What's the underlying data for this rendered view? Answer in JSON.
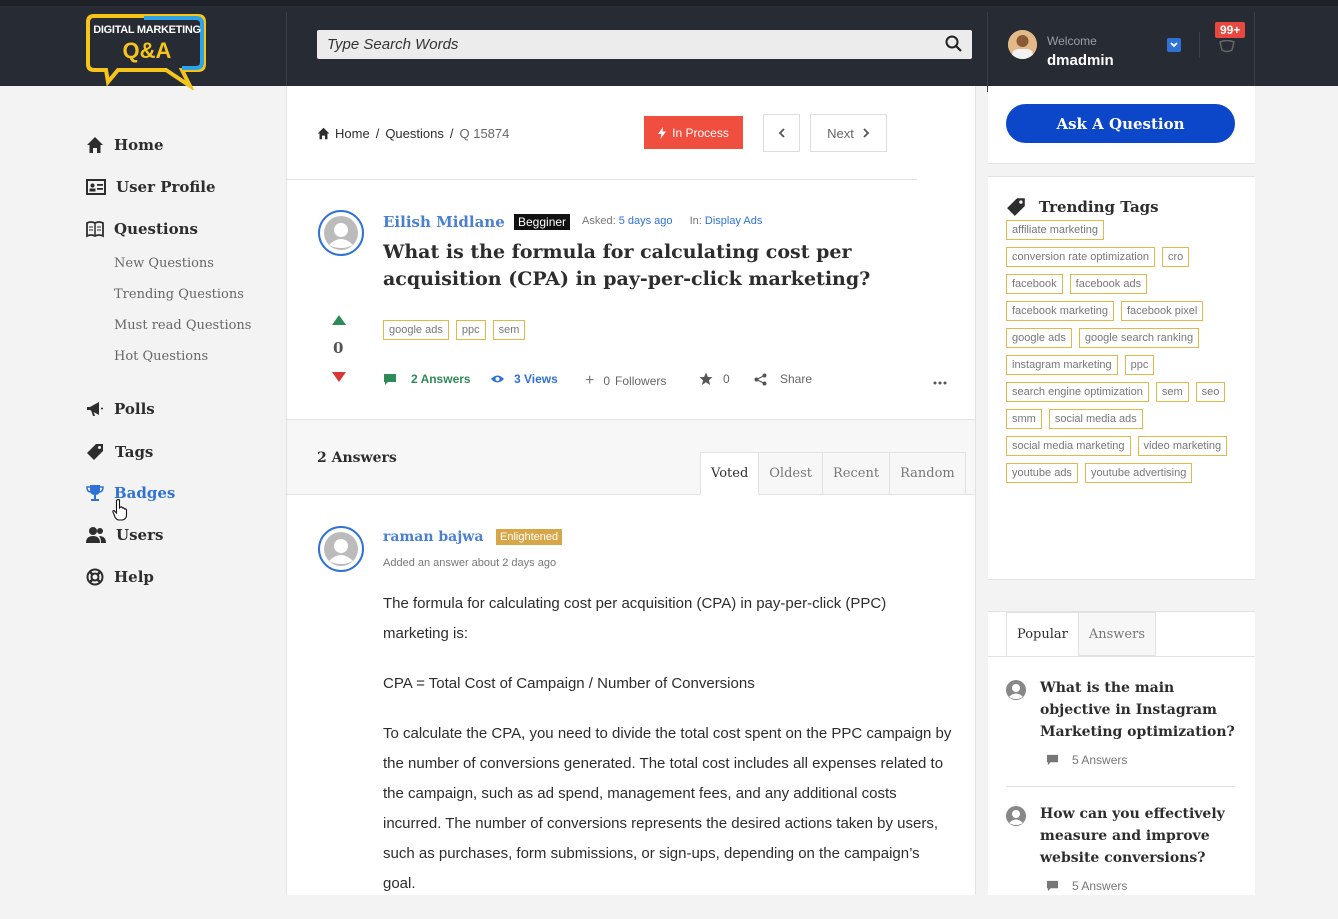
{
  "header": {
    "logo_line1": "DIGITAL MARKETING",
    "logo_line2": "Q&A",
    "search_placeholder": "Type Search Words",
    "welcome": "Welcome",
    "username": "dmadmin",
    "notif_count": "99+"
  },
  "sidebar": {
    "items": [
      {
        "label": "Home"
      },
      {
        "label": "User Profile"
      },
      {
        "label": "Questions"
      },
      {
        "label": "Polls"
      },
      {
        "label": "Tags"
      },
      {
        "label": "Badges"
      },
      {
        "label": "Users"
      },
      {
        "label": "Help"
      }
    ],
    "sub_items": [
      {
        "label": "New Questions"
      },
      {
        "label": "Trending Questions"
      },
      {
        "label": "Must read Questions"
      },
      {
        "label": "Hot Questions"
      }
    ]
  },
  "breadcrumb": {
    "home": "Home",
    "sep": "/",
    "questions": "Questions",
    "current": "Q 15874"
  },
  "status_label": "In Process",
  "pager": {
    "next": "Next"
  },
  "question": {
    "author": "Eilish Midlane",
    "badge": "Begginer",
    "asked_label": "Asked:",
    "asked_time": "5 days ago",
    "in_label": "In:",
    "category": "Display Ads",
    "title": "What is the formula for calculating cost per acquisition (CPA) in pay-per-click marketing?",
    "tags": [
      "google ads",
      "ppc",
      "sem"
    ],
    "votes": "0",
    "answers": "2 Answers",
    "views": "3 Views",
    "followers_count": "0",
    "followers_label": "Followers",
    "stars": "0",
    "share": "Share"
  },
  "answers_section": {
    "title": "2 Answers",
    "tabs": [
      "Voted",
      "Oldest",
      "Recent",
      "Random"
    ]
  },
  "answer": {
    "author": "raman bajwa",
    "badge": "Enlightened",
    "added": "Added an answer about 2 days ago",
    "p1": "The formula for calculating cost per acquisition (CPA) in pay-per-click (PPC) marketing is:",
    "p2": "CPA = Total Cost of Campaign / Number of Conversions",
    "p3": "To calculate the CPA, you need to divide the total cost spent on the PPC campaign by the number of conversions generated. The total cost includes all expenses related to the campaign, such as ad spend, management fees, and any additional costs incurred. The number of conversions represents the desired actions taken by users, such as purchases, form submissions, or sign-ups, depending on the campaign’s goal."
  },
  "right": {
    "ask_button": "Ask A Question",
    "trending_title": "Trending Tags",
    "trending_tags": [
      "affiliate marketing",
      "conversion rate optimization",
      "cro",
      "facebook",
      "facebook ads",
      "facebook marketing",
      "facebook pixel",
      "google ads",
      "google search ranking",
      "instagram marketing",
      "ppc",
      "search engine optimization",
      "sem",
      "seo",
      "smm",
      "social media ads",
      "social media marketing",
      "video marketing",
      "youtube ads",
      "youtube advertising"
    ],
    "tabs": [
      "Popular",
      "Answers"
    ],
    "popular": [
      {
        "title": "What is the main objective in Instagram Marketing optimization?",
        "answers": "5 Answers"
      },
      {
        "title": "How can you effectively measure and improve website conversions?",
        "answers": "5 Answers"
      }
    ]
  },
  "colors": {
    "accent": "#2f72d6",
    "status": "#f04e3e",
    "ask_button": "#0d47c9",
    "badge_gold": "#d6a649"
  }
}
